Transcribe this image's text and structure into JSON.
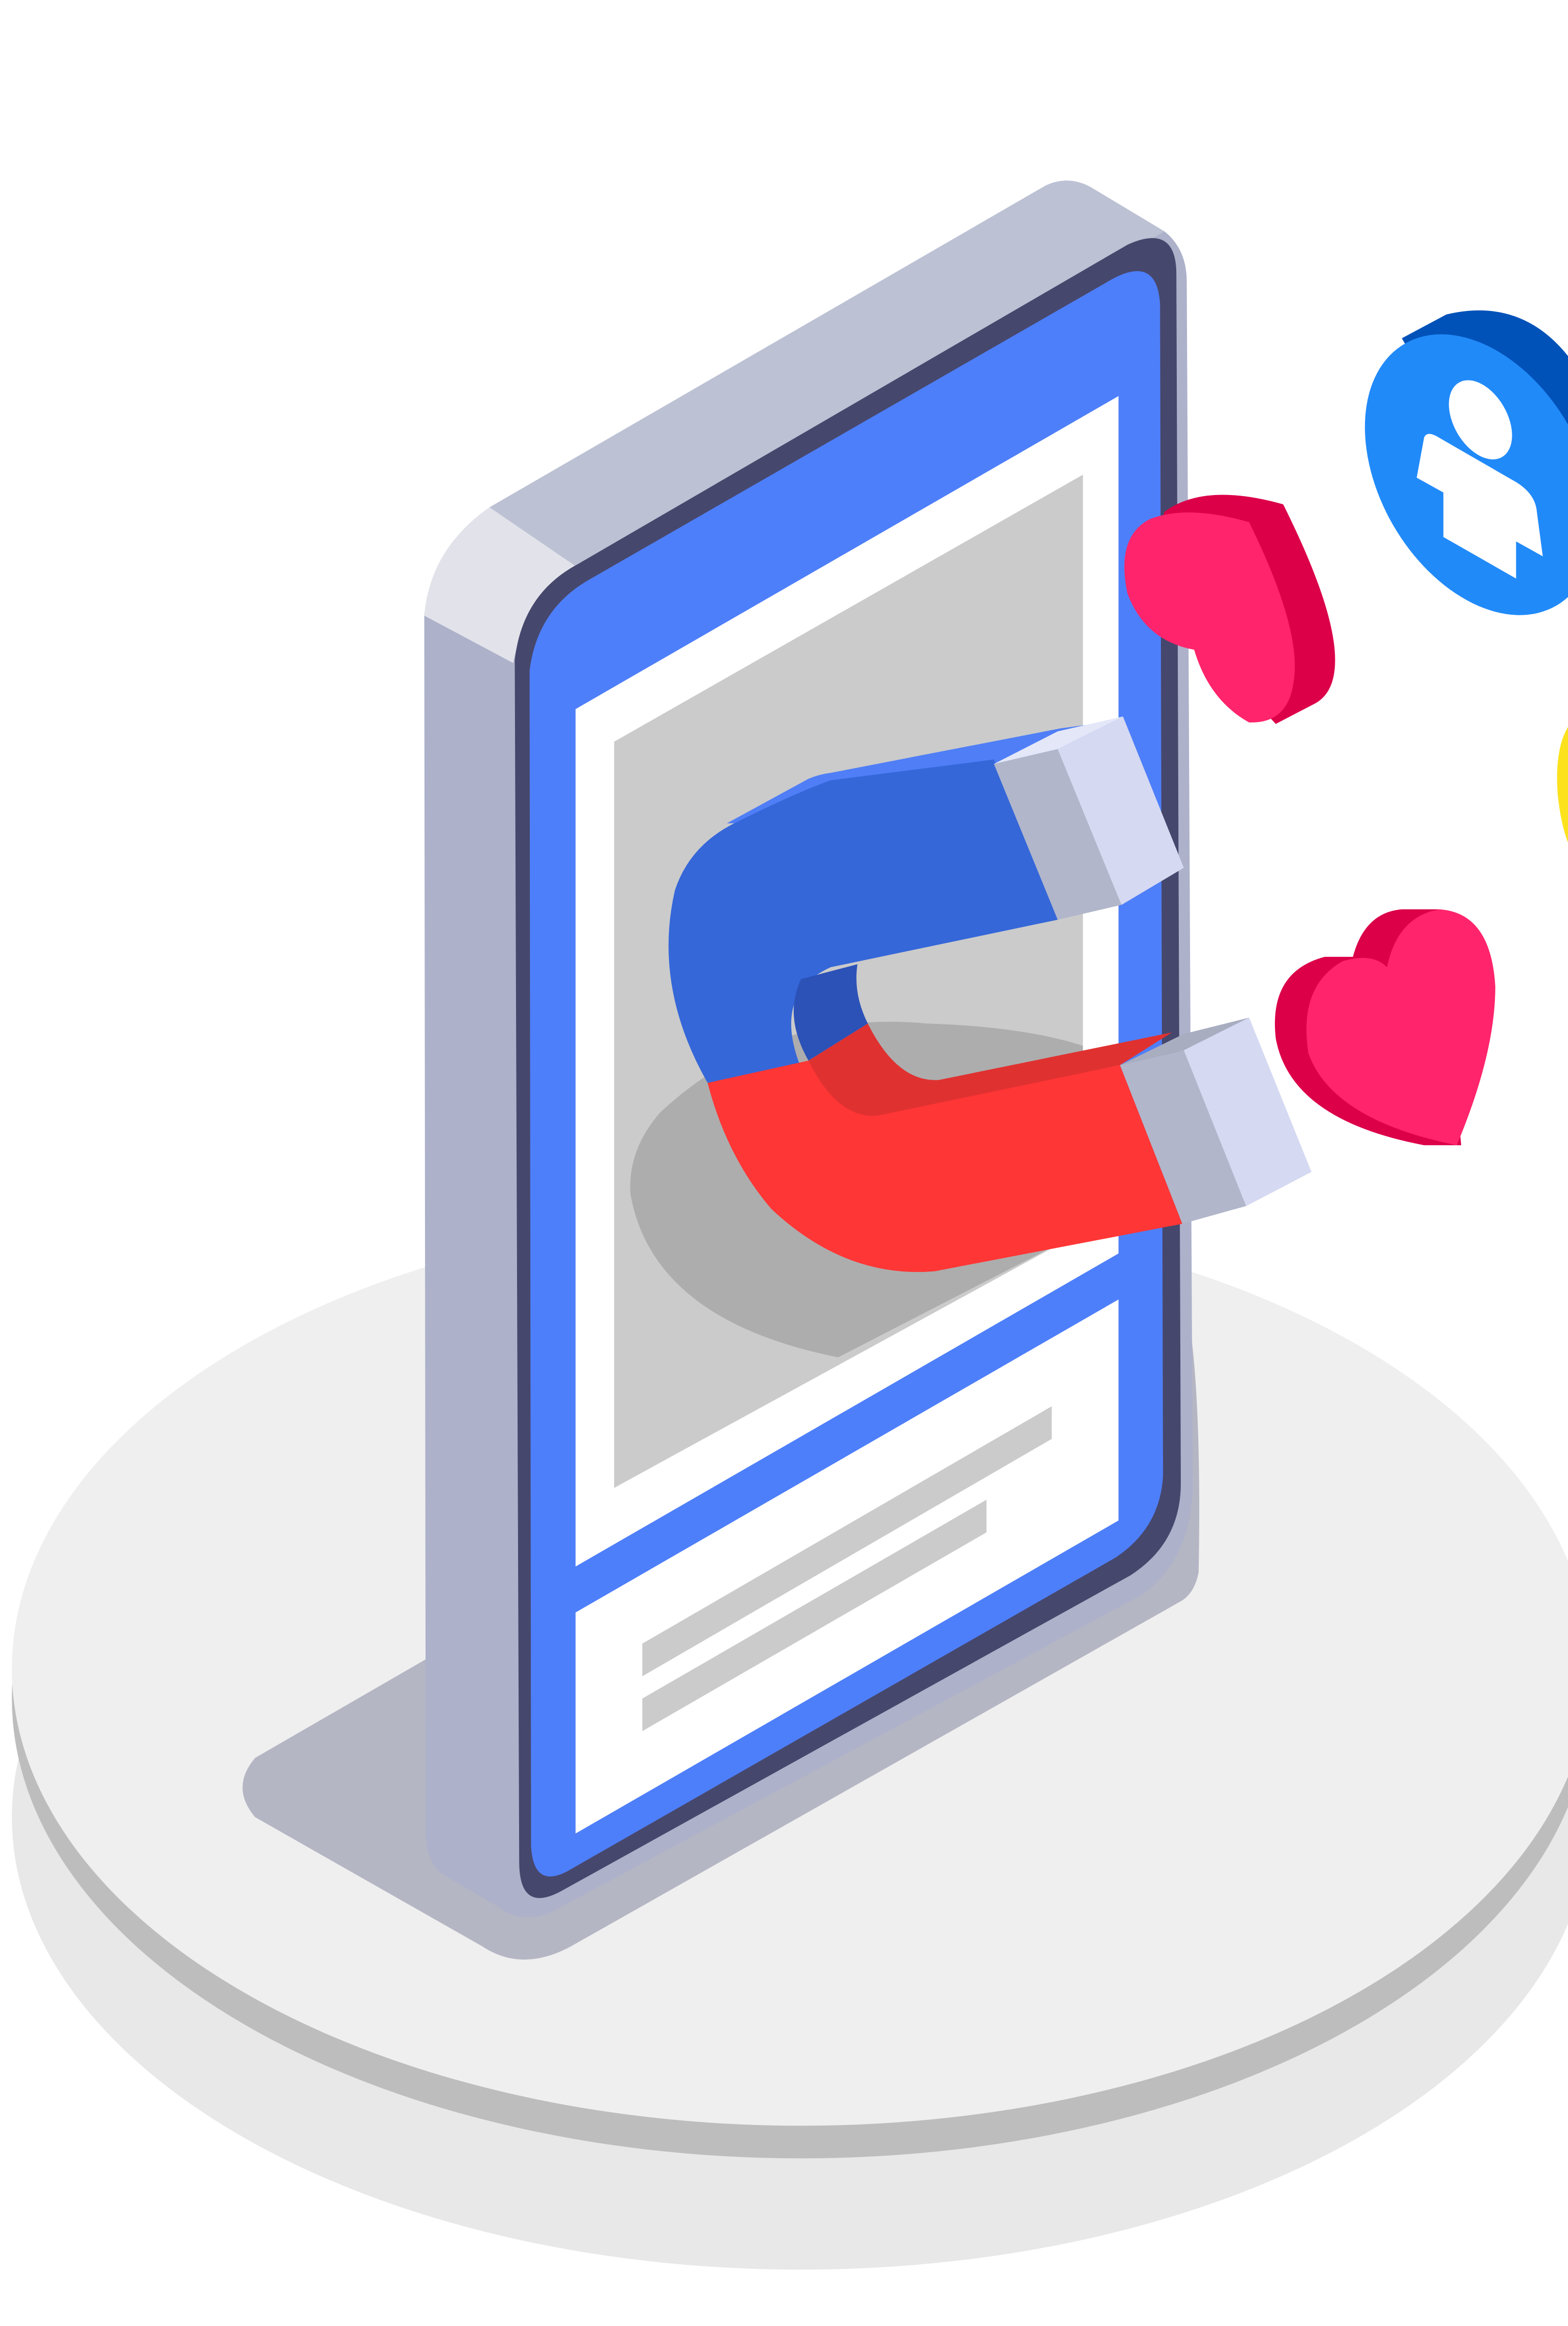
{
  "illustration": {
    "subject": "magnet-attracting-likes-to-smartphone",
    "icons": [
      "magnet-icon",
      "heart-icon",
      "heart-icon",
      "user-badge-icon",
      "coin-icon"
    ],
    "colors": {
      "phone_screen": "#4e7ffa",
      "phone_body": "#bcc1d4",
      "phone_bezel": "#46476c",
      "magnet_blue": "#3567d9",
      "magnet_red": "#fe3635",
      "magnet_tip": "#d5d9f2",
      "heart": "#ff246b",
      "heart_dark": "#dc0049",
      "badge": "#218af9",
      "coin": "#fbe21d",
      "platform": "#efefef",
      "placeholder": "#cbcbcb"
    }
  }
}
